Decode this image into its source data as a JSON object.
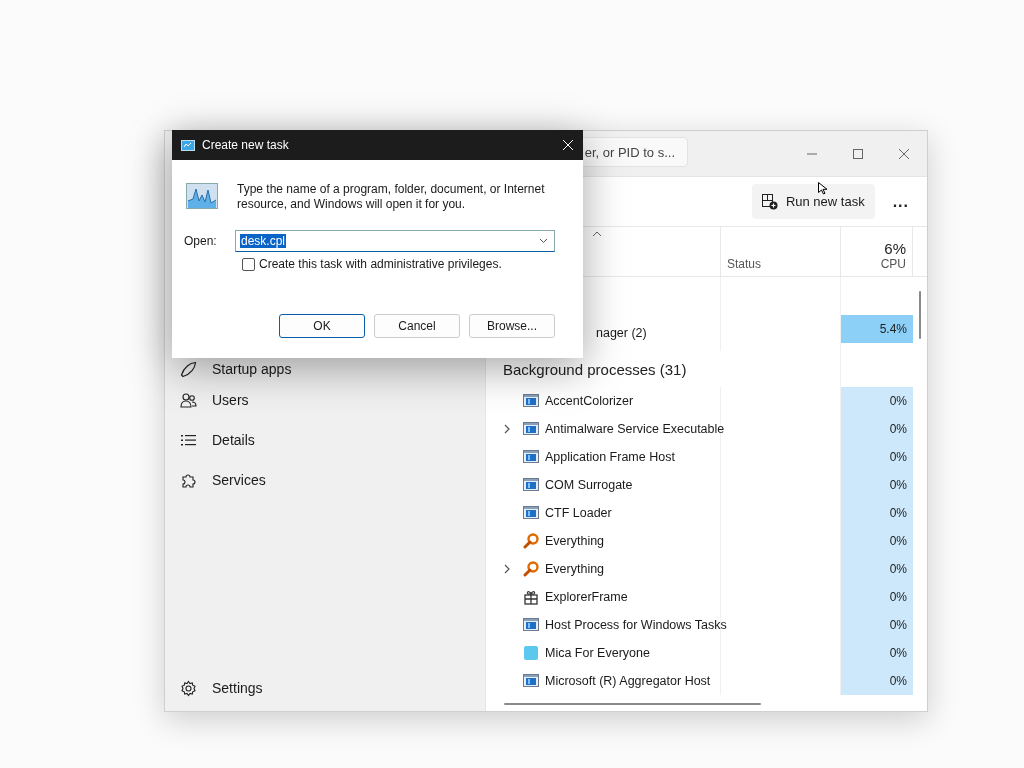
{
  "task_manager": {
    "search": {
      "placeholder": "er, or PID to s..."
    },
    "toolbar": {
      "run_new_task": "Run new task",
      "more": "..."
    },
    "sidebar": {
      "items": [
        {
          "label": "Startup apps"
        },
        {
          "label": "Users"
        },
        {
          "label": "Details"
        },
        {
          "label": "Services"
        }
      ],
      "settings": {
        "label": "Settings"
      }
    },
    "columns": {
      "status": "Status",
      "cpu_total": "6%",
      "cpu": "CPU"
    },
    "rows": [
      {
        "kind": "app",
        "name": "nager (2)",
        "cpu": "5.4%",
        "color": "#8ccff7",
        "expandable": false
      },
      {
        "kind": "group",
        "name": "Background processes (31)"
      },
      {
        "kind": "window",
        "name": "AccentColorizer",
        "cpu": "0%",
        "color": "#cce8fa",
        "expandable": false
      },
      {
        "kind": "window",
        "name": "Antimalware Service Executable",
        "cpu": "0%",
        "color": "#cce8fa",
        "expandable": true
      },
      {
        "kind": "window",
        "name": "Application Frame Host",
        "cpu": "0%",
        "color": "#cce8fa",
        "expandable": false
      },
      {
        "kind": "window",
        "name": "COM Surrogate",
        "cpu": "0%",
        "color": "#cce8fa",
        "expandable": false
      },
      {
        "kind": "window",
        "name": "CTF Loader",
        "cpu": "0%",
        "color": "#cce8fa",
        "expandable": false
      },
      {
        "kind": "magnifier",
        "name": "Everything",
        "cpu": "0%",
        "color": "#cce8fa",
        "expandable": false
      },
      {
        "kind": "magnifier",
        "name": "Everything",
        "cpu": "0%",
        "color": "#cce8fa",
        "expandable": true
      },
      {
        "kind": "gift",
        "name": "ExplorerFrame",
        "cpu": "0%",
        "color": "#cce8fa",
        "expandable": false
      },
      {
        "kind": "window",
        "name": "Host Process for Windows Tasks",
        "cpu": "0%",
        "color": "#cce8fa",
        "expandable": false
      },
      {
        "kind": "tile",
        "name": "Mica For Everyone",
        "cpu": "0%",
        "color": "#cce8fa",
        "expandable": false
      },
      {
        "kind": "window",
        "name": "Microsoft (R) Aggregator Host",
        "cpu": "0%",
        "color": "#cce8fa",
        "expandable": false
      }
    ]
  },
  "dialog": {
    "title": "Create new task",
    "message": "Type the name of a program, folder, document, or Internet resource, and Windows will open it for you.",
    "open_label": "Open:",
    "open_value": "desk.cpl",
    "value_selected": true,
    "admin_checkbox": {
      "label": "Create this task with administrative privileges.",
      "checked": false
    },
    "buttons": [
      {
        "label": "OK",
        "default": true
      },
      {
        "label": "Cancel",
        "default": false
      },
      {
        "label": "Browse...",
        "default": false
      }
    ]
  }
}
